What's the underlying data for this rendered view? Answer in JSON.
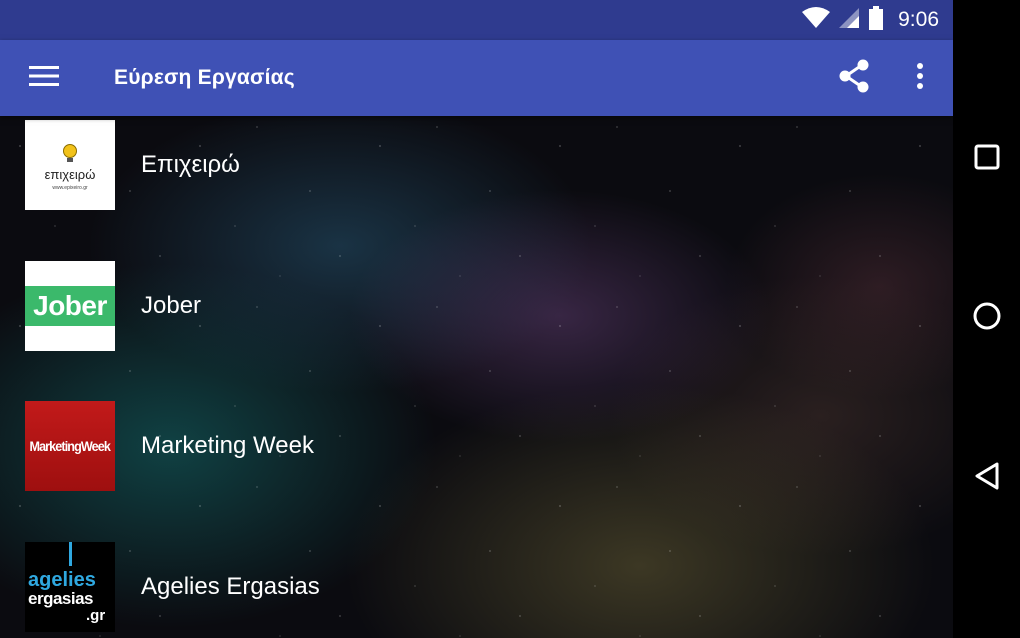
{
  "status_bar": {
    "time": "9:06",
    "icons": [
      "wifi-icon",
      "signal-icon",
      "battery-icon"
    ]
  },
  "app_bar": {
    "title": "Εύρεση Εργασίας",
    "menu_icon": "hamburger-menu-icon",
    "actions": [
      "share-icon",
      "overflow-menu-icon"
    ]
  },
  "list": {
    "items": [
      {
        "label": "Επιχειρώ",
        "logo": {
          "word": "επιχειρώ",
          "url": "www.epixeiro.gr"
        }
      },
      {
        "label": "Jober",
        "logo": {
          "word": "Jober"
        }
      },
      {
        "label": "Marketing Week",
        "logo": {
          "word": "MarketingWeek"
        }
      },
      {
        "label": "Agelies Ergasias",
        "logo": {
          "line1": "agelies",
          "line2": "ergasias",
          "line3": ".gr"
        }
      }
    ]
  },
  "nav_bar": {
    "buttons": [
      "recents-square-icon",
      "home-circle-icon",
      "back-triangle-icon"
    ]
  },
  "colors": {
    "status_bar": "#2f3b8f",
    "app_bar": "#3f51b5",
    "jober_green": "#3bb96b",
    "marketing_red": "#c21a1a",
    "agelies_blue": "#2fa8e0"
  }
}
